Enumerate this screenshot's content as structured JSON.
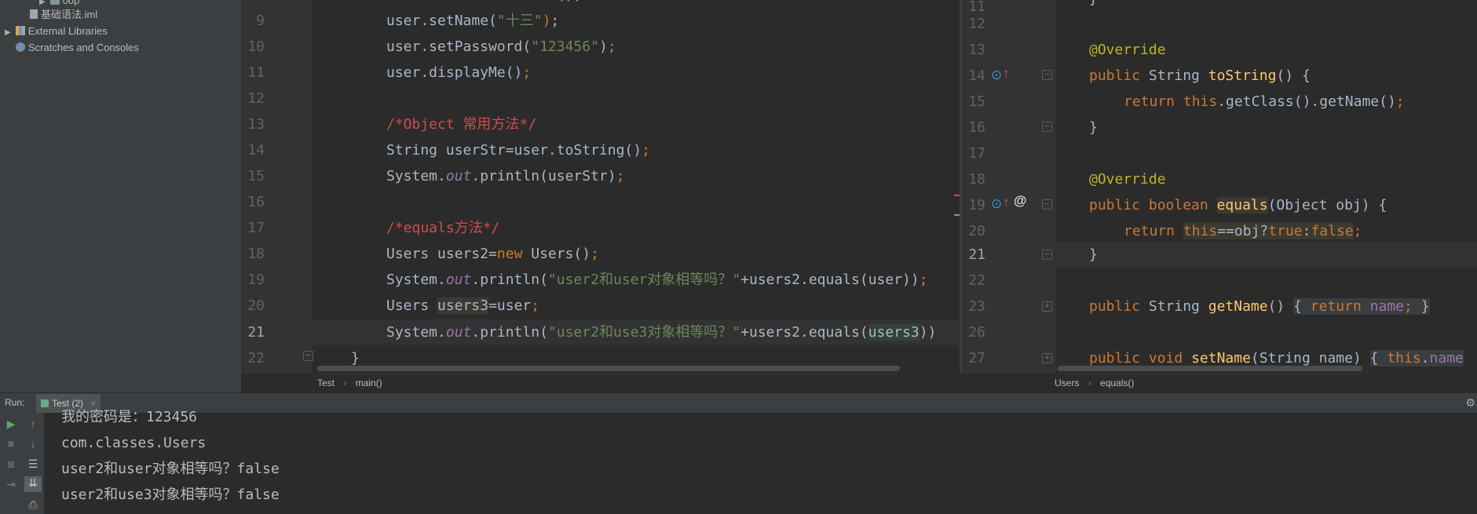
{
  "project": {
    "items": [
      {
        "label": "oop",
        "kind": "folder"
      },
      {
        "label": "基础语法.iml",
        "kind": "file"
      },
      {
        "label": "External Libraries",
        "kind": "library"
      },
      {
        "label": "Scratches and Consoles",
        "kind": "scratch"
      }
    ]
  },
  "left_editor": {
    "line_numbers": [
      "9",
      "10",
      "11",
      "12",
      "13",
      "14",
      "15",
      "16",
      "17",
      "18",
      "19",
      "20",
      "21",
      "22"
    ],
    "current_line": "21",
    "breadcrumb": [
      "Test",
      "main()"
    ]
  },
  "right_editor": {
    "line_numbers": [
      "11",
      "12",
      "13",
      "14",
      "15",
      "16",
      "17",
      "18",
      "19",
      "20",
      "21",
      "22",
      "23",
      "26",
      "27"
    ],
    "current_line": "21",
    "breadcrumb": [
      "Users",
      "equals()"
    ]
  },
  "run": {
    "label": "Run:",
    "tab": "Test (2)",
    "output": [
      "我的密码是：123456",
      "com.classes.Users",
      "user2和user对象相等吗？false",
      "user2和use3对象相等吗？false"
    ]
  },
  "colors": {
    "keyword": "#cc7832",
    "string": "#6a8759",
    "comment": "#d44b4b",
    "annotation": "#bbb529",
    "function": "#ffc66d"
  }
}
